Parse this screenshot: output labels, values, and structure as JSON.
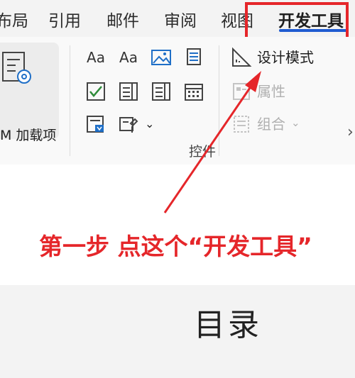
{
  "tabs": [
    {
      "label": "布局"
    },
    {
      "label": "引用"
    },
    {
      "label": "邮件"
    },
    {
      "label": "审阅"
    },
    {
      "label": "视图"
    },
    {
      "label": "开发工具"
    }
  ],
  "ribbon": {
    "addins_label": "M 加载项",
    "design_mode": "设计模式",
    "properties": "属性",
    "group": "组合",
    "group_name": "控件",
    "aa1": "Aa",
    "aa2": "Aa"
  },
  "annotation": {
    "text": "第一步 点这个“开发工具”"
  },
  "document": {
    "title": "目录"
  },
  "colors": {
    "accent_red": "#e5262a",
    "tab_underline": "#1f5bd1"
  }
}
